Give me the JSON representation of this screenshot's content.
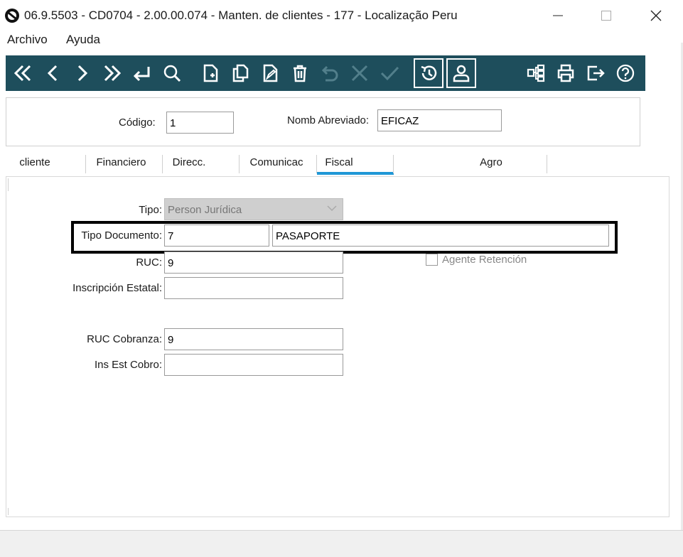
{
  "window": {
    "title": "06.9.5503 - CD0704 - 2.00.00.074 - Manten. de clientes - 177 - Localização Peru"
  },
  "menu": {
    "items": [
      "Archivo",
      "Ayuda"
    ]
  },
  "toolbar": {
    "buttons": [
      "first-record-icon",
      "previous-record-icon",
      "next-record-icon",
      "last-record-icon",
      "return-icon",
      "search-icon",
      "new-document-icon",
      "copy-icon",
      "edit-icon",
      "delete-icon",
      "undo-icon",
      "cancel-icon",
      "confirm-icon",
      "history-icon",
      "user-icon",
      "hierarchy-icon",
      "print-icon",
      "exit-icon",
      "help-icon"
    ],
    "bg_color": "#1e4e5c"
  },
  "header": {
    "codigo_label": "Código:",
    "codigo_value": "1",
    "nomb_label": "Nomb Abreviado:",
    "nomb_value": "EFICAZ"
  },
  "tabs": {
    "items": [
      "cliente",
      "Financiero",
      "Direcc.",
      "Comunicac",
      "Fiscal",
      "Agro"
    ],
    "active": "Fiscal",
    "active_color": "#1f97d6"
  },
  "fiscal": {
    "tipo_label": "Tipo:",
    "tipo_value": "Person Jurídica",
    "tipo_doc_label": "Tipo Documento:",
    "tipo_doc_code": "7",
    "tipo_doc_desc": "PASAPORTE",
    "ruc_label": "RUC:",
    "ruc_value": "9",
    "agente_label": "Agente Retención",
    "agente_checked": false,
    "inscripcion_label": "Inscripción Estatal:",
    "inscripcion_value": "",
    "ruc_cobranza_label": "RUC Cobranza:",
    "ruc_cobranza_value": "9",
    "ins_est_label": "Ins Est Cobro:",
    "ins_est_value": ""
  }
}
